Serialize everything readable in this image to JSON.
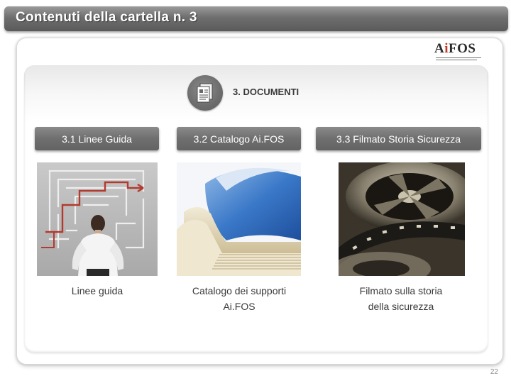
{
  "header": {
    "title": "Contenuti della cartella n. 3"
  },
  "logo": {
    "text_prefix": "A",
    "text_highlight": "i",
    "text_suffix": "FOS"
  },
  "section": {
    "title": "3. DOCUMENTI",
    "icon": "document-icon"
  },
  "items": [
    {
      "button_label": "3.1 Linee Guida",
      "image_icon": "maze-businessman-image",
      "caption_lines": [
        "Linee guida"
      ]
    },
    {
      "button_label": "3.2 Catalogo Ai.FOS",
      "image_icon": "catalog-pages-image",
      "caption_lines": [
        "Catalogo dei supporti",
        "Ai.FOS"
      ]
    },
    {
      "button_label": "3.3 Filmato Storia Sicurezza",
      "image_icon": "film-reel-image",
      "caption_lines": [
        "Filmato sulla storia",
        "della sicurezza"
      ]
    }
  ],
  "footer": {
    "page_number": "22"
  },
  "colors": {
    "title_bar": "#6e6e6e",
    "button": "#6f6f6f",
    "logo_accent": "#c0392b"
  }
}
